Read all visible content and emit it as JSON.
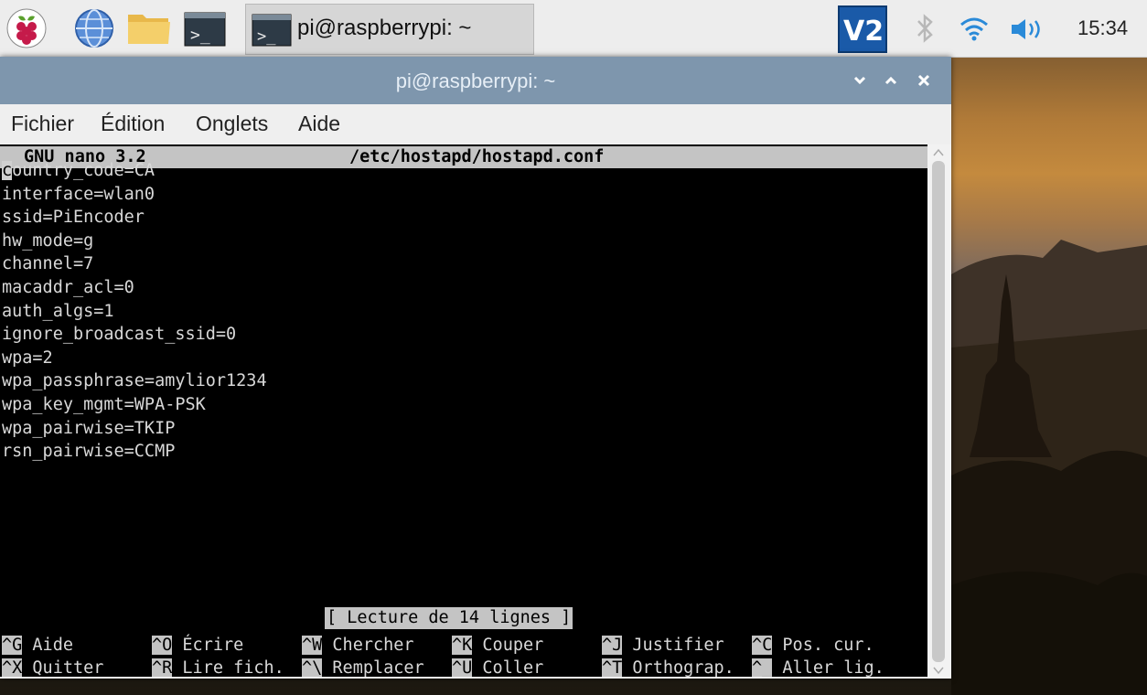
{
  "taskbar": {
    "launchers": [
      "raspberry-menu-icon",
      "web-browser-icon",
      "file-manager-icon",
      "terminal-icon"
    ],
    "task_label": "pi@raspberrypi: ~",
    "tray_icons": [
      "vnc-icon",
      "bluetooth-icon",
      "wifi-icon",
      "volume-icon"
    ],
    "clock": "15:34"
  },
  "window": {
    "title": "pi@raspberrypi: ~",
    "menu": [
      "Fichier",
      "Édition",
      "Onglets",
      "Aide"
    ]
  },
  "nano": {
    "version": "GNU nano 3.2",
    "filename": "/etc/hostapd/hostapd.conf",
    "lines": [
      "country_code=CA",
      "interface=wlan0",
      "ssid=PiEncoder",
      "hw_mode=g",
      "channel=7",
      "macaddr_acl=0",
      "auth_algs=1",
      "ignore_broadcast_ssid=0",
      "wpa=2",
      "wpa_passphrase=amylior1234",
      "wpa_key_mgmt=WPA-PSK",
      "wpa_pairwise=TKIP",
      "rsn_pairwise=CCMP"
    ],
    "status": "[ Lecture de 14 lignes ]",
    "shortcuts_row1": [
      {
        "key": "^G",
        "label": "Aide"
      },
      {
        "key": "^O",
        "label": "Écrire"
      },
      {
        "key": "^W",
        "label": "Chercher"
      },
      {
        "key": "^K",
        "label": "Couper"
      },
      {
        "key": "^J",
        "label": "Justifier"
      },
      {
        "key": "^C",
        "label": "Pos. cur."
      }
    ],
    "shortcuts_row2": [
      {
        "key": "^X",
        "label": "Quitter"
      },
      {
        "key": "^R",
        "label": "Lire fich."
      },
      {
        "key": "^\\",
        "label": "Remplacer"
      },
      {
        "key": "^U",
        "label": "Coller"
      },
      {
        "key": "^T",
        "label": "Orthograp."
      },
      {
        "key": "^_",
        "label": "Aller lig."
      }
    ]
  }
}
